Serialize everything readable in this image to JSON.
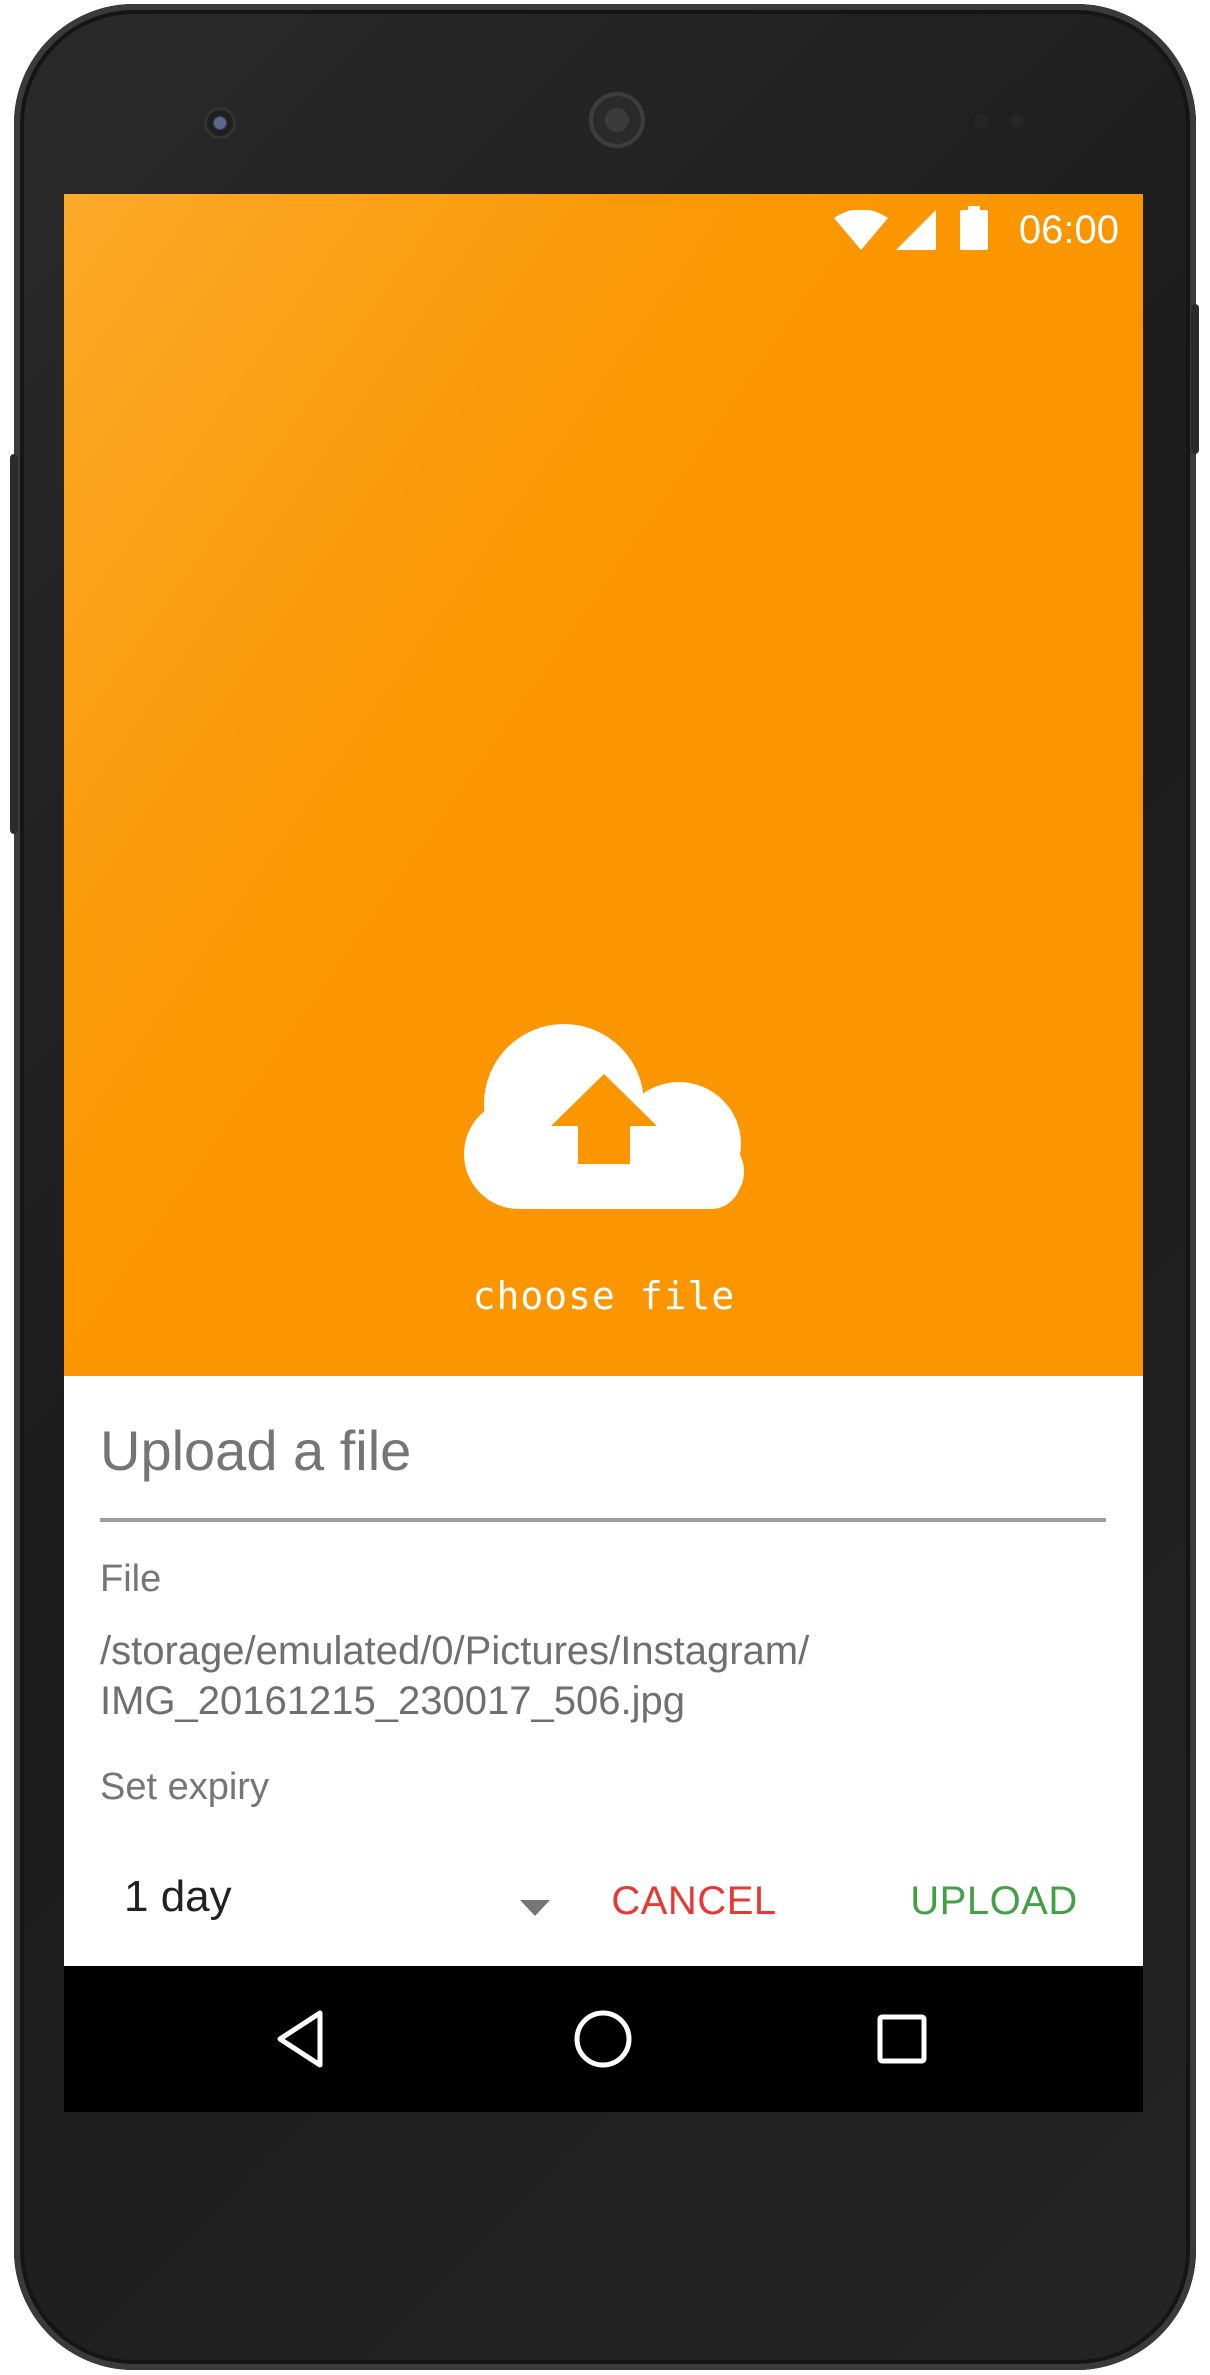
{
  "status_bar": {
    "time": "06:00",
    "icons": [
      "wifi-icon",
      "cell-signal-icon",
      "battery-icon"
    ]
  },
  "upload_area": {
    "icon": "cloud-upload-icon",
    "label": "choose file"
  },
  "dialog": {
    "title": "Upload a file",
    "file_label": "File",
    "file_path_line1": "/storage/emulated/0/Pictures/Instagram/",
    "file_path_line2": "IMG_20161215_230017_506.jpg",
    "expiry_label": "Set expiry",
    "expiry_value": "1 day",
    "cancel_label": "CANCEL",
    "upload_label": "UPLOAD"
  },
  "nav_bar": {
    "icons": [
      "back-icon",
      "home-icon",
      "recents-icon"
    ]
  },
  "colors": {
    "accent": "#fb9600",
    "cancel": "#e53935",
    "upload": "#43a047",
    "text_secondary": "#757575"
  }
}
